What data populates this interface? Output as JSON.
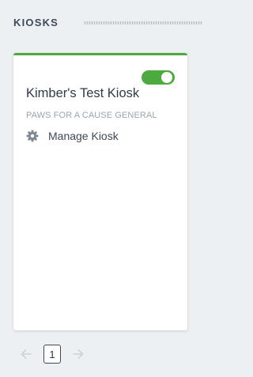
{
  "section": {
    "title": "KIOSKS"
  },
  "kiosk_card": {
    "name": "Kimber's Test Kiosk",
    "subtitle": "PAWS FOR A CAUSE GENERAL",
    "manage_label": "Manage Kiosk",
    "enabled": true
  },
  "pagination": {
    "current_page": "1",
    "prev_icon": "arrow-left-icon",
    "next_icon": "arrow-right-icon"
  },
  "colors": {
    "accent_green": "#4caa3f",
    "background": "#edf0f2",
    "text_dark": "#2d3b4a",
    "text_muted": "#9aa4ae"
  }
}
